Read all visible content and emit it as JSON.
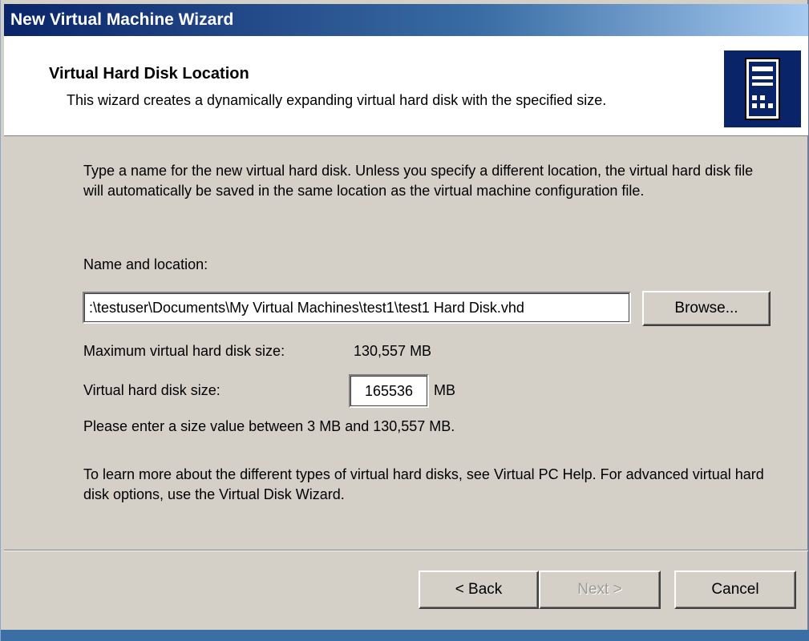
{
  "window": {
    "title": "New Virtual Machine Wizard"
  },
  "header": {
    "title": "Virtual Hard Disk Location",
    "subtitle": "This wizard creates a dynamically expanding virtual hard disk with the specified size.",
    "icon": "server-tower-icon"
  },
  "main": {
    "intro": "Type a name for the new virtual hard disk. Unless you specify a different location, the virtual hard disk file will automatically be saved in the same location as the virtual machine configuration file.",
    "name_label": "Name and location:",
    "path_value": ":\\testuser\\Documents\\My Virtual Machines\\test1\\test1 Hard Disk.vhd",
    "browse_label": "Browse...",
    "max_size_label": "Maximum virtual hard disk size:",
    "max_size_value": "130,557 MB",
    "size_label": "Virtual hard disk size:",
    "size_value": "165536",
    "size_unit": "MB",
    "hint": "Please enter a size value between 3 MB and 130,557 MB.",
    "learn_more": "To learn more about the different types of virtual hard disks, see Virtual PC Help. For advanced virtual hard disk options, use the Virtual Disk Wizard."
  },
  "footer": {
    "back_label": "< Back",
    "next_label": "Next >",
    "cancel_label": "Cancel"
  },
  "colors": {
    "titlebar_start": "#0a246a",
    "titlebar_end": "#a6caf0",
    "dialog_bg": "#d4d0c8",
    "disabled_text": "#9c9a94"
  }
}
